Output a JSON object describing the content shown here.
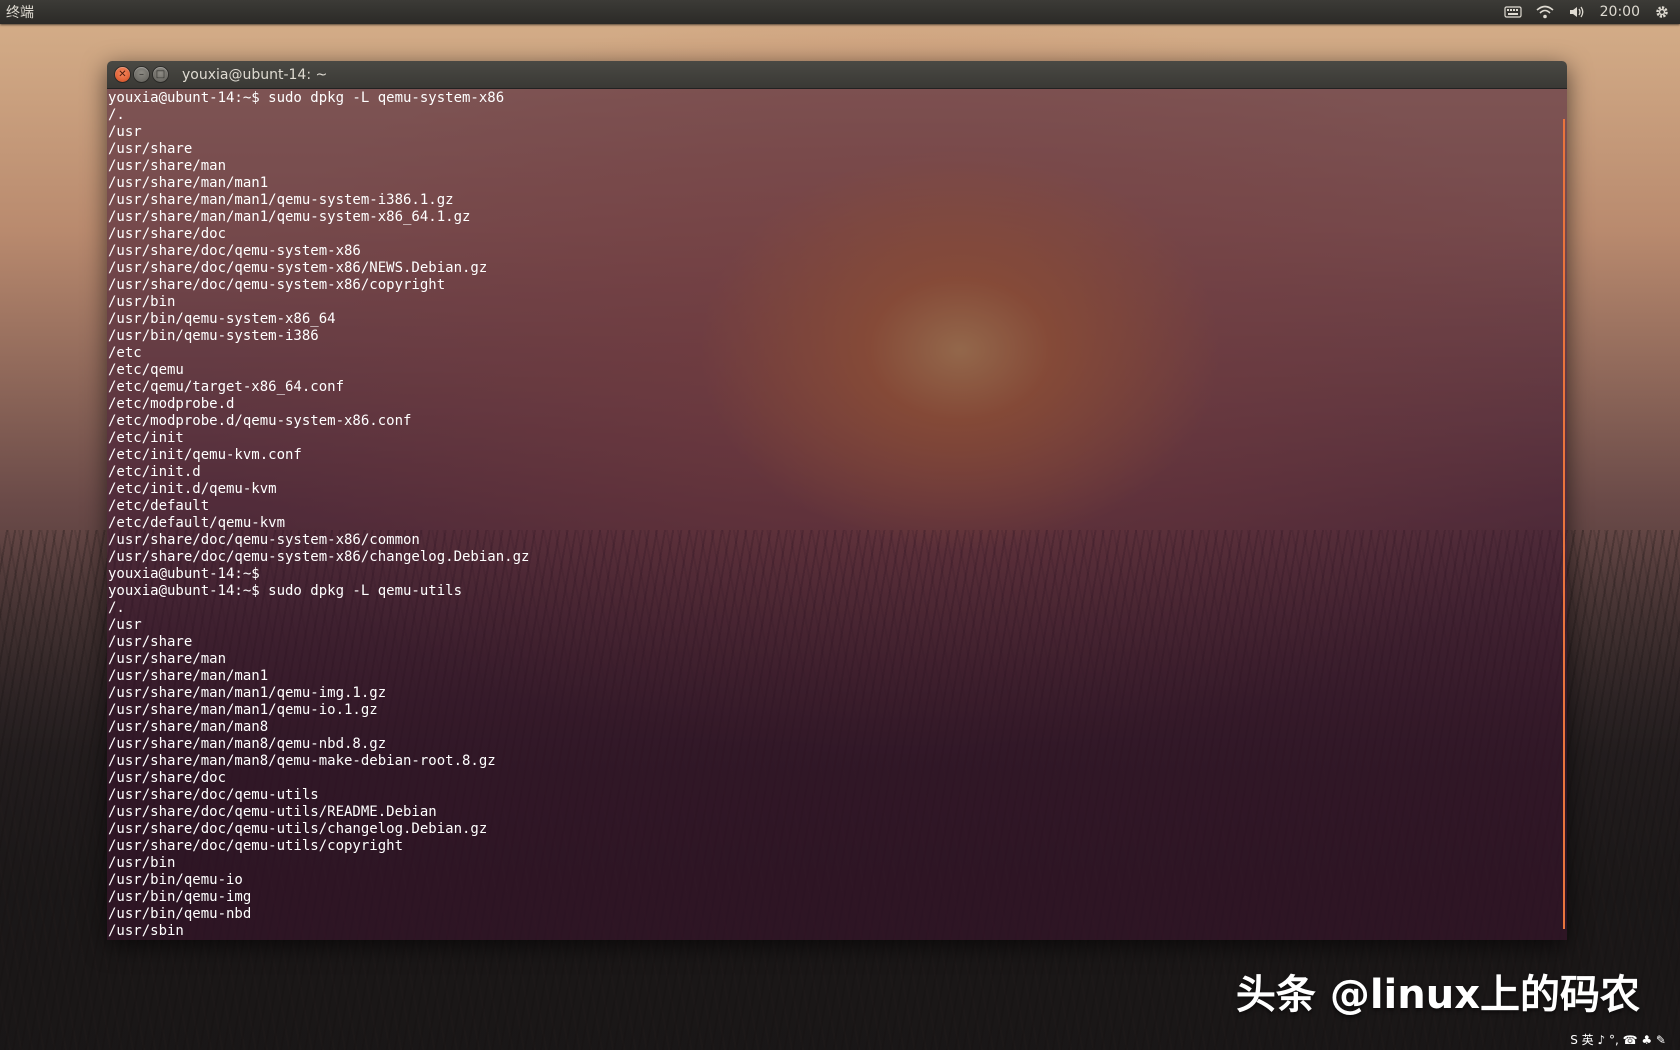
{
  "top_panel": {
    "app_title": "终端",
    "clock": "20:00",
    "icons": [
      "keyboard-icon",
      "wifi-icon",
      "volume-icon",
      "gear-icon"
    ]
  },
  "window": {
    "title": "youxia@ubunt-14: ~",
    "buttons": {
      "close": "close-icon",
      "minimize": "minimize-icon",
      "maximize": "maximize-icon"
    }
  },
  "terminal": {
    "lines": [
      "youxia@ubunt-14:~$ sudo dpkg -L qemu-system-x86",
      "/.",
      "/usr",
      "/usr/share",
      "/usr/share/man",
      "/usr/share/man/man1",
      "/usr/share/man/man1/qemu-system-i386.1.gz",
      "/usr/share/man/man1/qemu-system-x86_64.1.gz",
      "/usr/share/doc",
      "/usr/share/doc/qemu-system-x86",
      "/usr/share/doc/qemu-system-x86/NEWS.Debian.gz",
      "/usr/share/doc/qemu-system-x86/copyright",
      "/usr/bin",
      "/usr/bin/qemu-system-x86_64",
      "/usr/bin/qemu-system-i386",
      "/etc",
      "/etc/qemu",
      "/etc/qemu/target-x86_64.conf",
      "/etc/modprobe.d",
      "/etc/modprobe.d/qemu-system-x86.conf",
      "/etc/init",
      "/etc/init/qemu-kvm.conf",
      "/etc/init.d",
      "/etc/init.d/qemu-kvm",
      "/etc/default",
      "/etc/default/qemu-kvm",
      "/usr/share/doc/qemu-system-x86/common",
      "/usr/share/doc/qemu-system-x86/changelog.Debian.gz",
      "youxia@ubunt-14:~$",
      "youxia@ubunt-14:~$ sudo dpkg -L qemu-utils",
      "/.",
      "/usr",
      "/usr/share",
      "/usr/share/man",
      "/usr/share/man/man1",
      "/usr/share/man/man1/qemu-img.1.gz",
      "/usr/share/man/man1/qemu-io.1.gz",
      "/usr/share/man/man8",
      "/usr/share/man/man8/qemu-nbd.8.gz",
      "/usr/share/man/man8/qemu-make-debian-root.8.gz",
      "/usr/share/doc",
      "/usr/share/doc/qemu-utils",
      "/usr/share/doc/qemu-utils/README.Debian",
      "/usr/share/doc/qemu-utils/changelog.Debian.gz",
      "/usr/share/doc/qemu-utils/copyright",
      "/usr/bin",
      "/usr/bin/qemu-io",
      "/usr/bin/qemu-img",
      "/usr/bin/qemu-nbd",
      "/usr/sbin"
    ]
  },
  "watermark": "头条 @linux上的码农",
  "ime_bar": "S 英 ♪ °, ☎ ♣ ✎"
}
